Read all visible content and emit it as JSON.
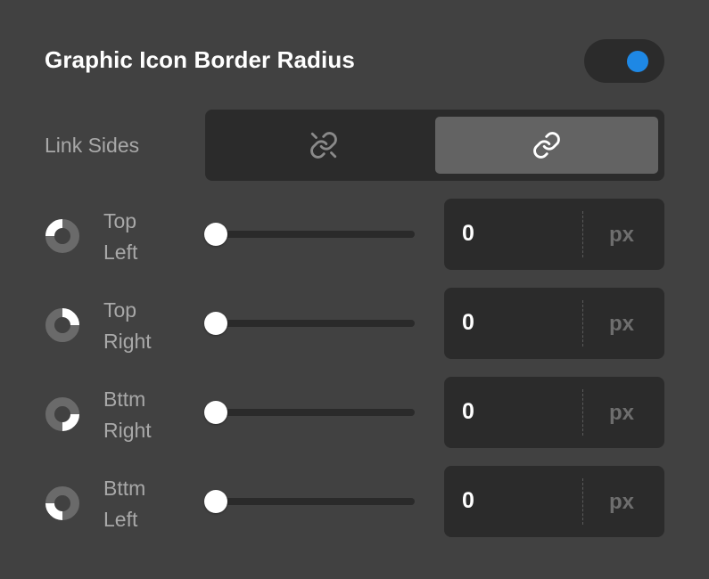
{
  "panel": {
    "title": "Graphic Icon Border Radius",
    "toggle_on": true,
    "accent_color": "#1e88e5"
  },
  "link_sides": {
    "label": "Link Sides",
    "options": [
      {
        "icon": "unlink-icon",
        "selected": false
      },
      {
        "icon": "link-icon",
        "selected": true
      }
    ]
  },
  "corners": [
    {
      "label_line1": "Top",
      "label_line2": "Left",
      "icon": "corner-top-left-icon",
      "value": "0",
      "unit": "px",
      "slider_fraction": 0
    },
    {
      "label_line1": "Top",
      "label_line2": "Right",
      "icon": "corner-top-right-icon",
      "value": "0",
      "unit": "px",
      "slider_fraction": 0
    },
    {
      "label_line1": "Bttm",
      "label_line2": "Right",
      "icon": "corner-bottom-right-icon",
      "value": "0",
      "unit": "px",
      "slider_fraction": 0
    },
    {
      "label_line1": "Bttm",
      "label_line2": "Left",
      "icon": "corner-bottom-left-icon",
      "value": "0",
      "unit": "px",
      "slider_fraction": 0
    }
  ]
}
